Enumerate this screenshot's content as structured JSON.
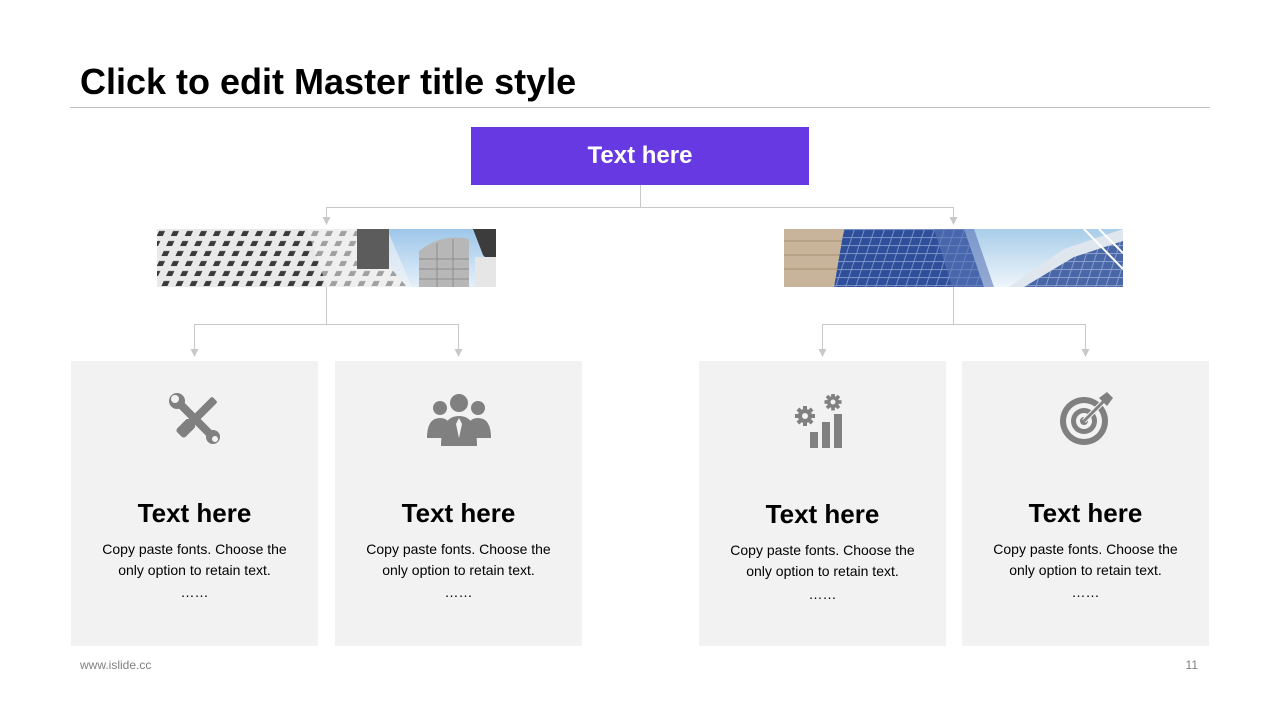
{
  "slide": {
    "title": "Click to edit Master title style",
    "footer_url": "www.islide.cc",
    "page_number": "11"
  },
  "colors": {
    "accent": "#6639e2",
    "card_bg": "#f2f2f2",
    "connector": "#c8c8c8",
    "icon": "#808080"
  },
  "root": {
    "label": "Text here"
  },
  "branches": [
    {
      "image": "architecture-photo-gray",
      "cards": [
        {
          "icon": "tools-icon",
          "title": "Text here",
          "body": "Copy paste fonts. Choose the only option to retain text.",
          "ellipsis": "……"
        },
        {
          "icon": "team-icon",
          "title": "Text here",
          "body": "Copy paste fonts. Choose the only option to retain text.",
          "ellipsis": "……"
        }
      ]
    },
    {
      "image": "architecture-photo-blue",
      "cards": [
        {
          "icon": "growth-chart-icon",
          "title": "Text here",
          "body": "Copy paste fonts. Choose the only option to retain text.",
          "ellipsis": "……"
        },
        {
          "icon": "target-icon",
          "title": "Text here",
          "body": "Copy paste fonts. Choose the only option to retain text.",
          "ellipsis": "……"
        }
      ]
    }
  ]
}
